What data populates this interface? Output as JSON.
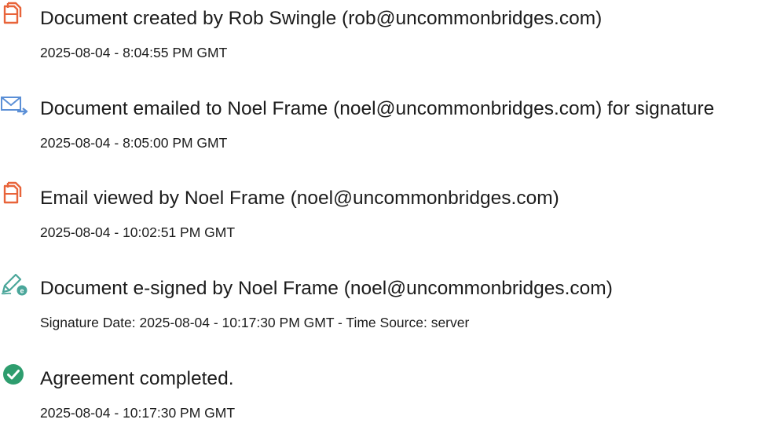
{
  "colors": {
    "doc_icon": "#e8643a",
    "email_icon": "#5b8fd6",
    "sign_icon": "#4aa69a",
    "check_icon": "#2e9d6e",
    "text": "#1c1c1c"
  },
  "events": [
    {
      "icon": "document-icon",
      "title": "Document created by Rob Swingle (rob@uncommonbridges.com)",
      "detail": "2025-08-04 - 8:04:55 PM GMT"
    },
    {
      "icon": "email-icon",
      "title": "Document emailed to Noel Frame (noel@uncommonbridges.com) for signature",
      "detail": "2025-08-04 - 8:05:00 PM GMT"
    },
    {
      "icon": "document-icon",
      "title": "Email viewed by Noel Frame (noel@uncommonbridges.com)",
      "detail": "2025-08-04 - 10:02:51 PM GMT"
    },
    {
      "icon": "esign-pen-icon",
      "title": "Document e-signed by Noel Frame (noel@uncommonbridges.com)",
      "detail": "Signature Date: 2025-08-04 - 10:17:30 PM GMT - Time Source: server"
    },
    {
      "icon": "checkmark-circle-icon",
      "title": "Agreement completed.",
      "detail": "2025-08-04 - 10:17:30 PM GMT"
    }
  ]
}
